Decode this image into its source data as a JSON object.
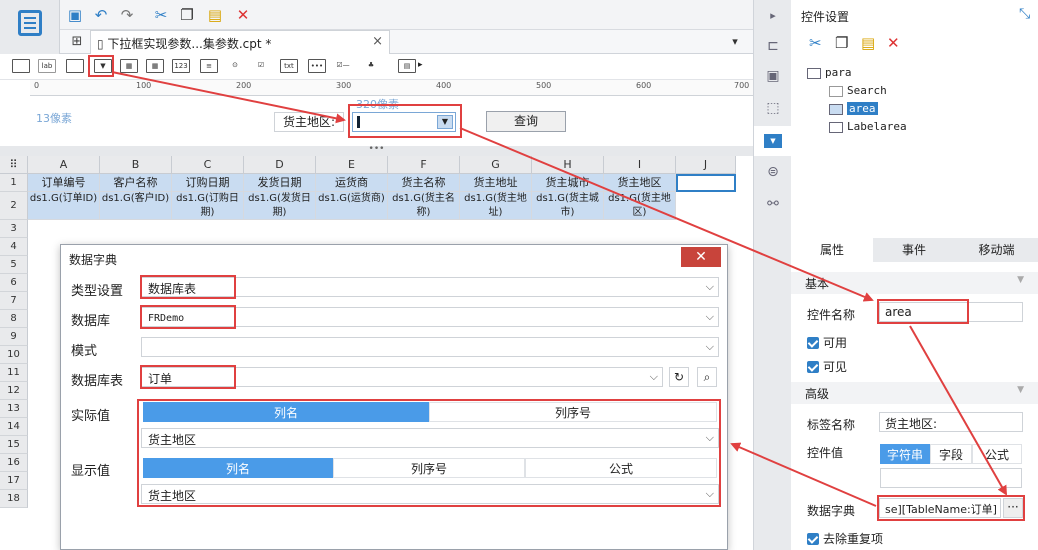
{
  "tab": {
    "title": "下拉框实现参数...集参数.cpt *",
    "close": "×"
  },
  "ruler": {
    "ticks": [
      "0",
      "100",
      "200",
      "300",
      "400",
      "500",
      "600",
      "700"
    ]
  },
  "param": {
    "margin_label": "13像素",
    "width_label": "320像素",
    "field_label": "货主地区:",
    "query_button": "查询",
    "collapse": "•••"
  },
  "grid": {
    "columns": [
      "A",
      "B",
      "C",
      "D",
      "E",
      "F",
      "G",
      "H",
      "I",
      "J"
    ],
    "rows": [
      "1",
      "2",
      "3",
      "4",
      "5",
      "6",
      "7",
      "8",
      "9",
      "10",
      "11",
      "12",
      "13",
      "14",
      "15",
      "16",
      "17",
      "18"
    ],
    "headers": [
      "订单编号",
      "客户名称",
      "订购日期",
      "发货日期",
      "运货商",
      "货主名称",
      "货主地址",
      "货主城市",
      "货主地区"
    ],
    "formulas": [
      "ds1.G(订单ID)",
      "ds1.G(客户ID)",
      "ds1.G(订购日期)",
      "ds1.G(发货日期)",
      "ds1.G(运货商)",
      "ds1.G(货主名称)",
      "ds1.G(货主地址)",
      "ds1.G(货主城市)",
      "ds1.G(货主地区)"
    ]
  },
  "panel": {
    "title": "控件设置",
    "tree": {
      "root": "para",
      "items": [
        "Search",
        "area",
        "Labelarea"
      ]
    },
    "tabs": [
      "属性",
      "事件",
      "移动端"
    ],
    "basic": "基本",
    "name_label": "控件名称",
    "name_value": "area",
    "enabled": "可用",
    "visible": "可见",
    "advanced": "高级",
    "tag_label": "标签名称",
    "tag_value": "货主地区:",
    "value_label": "控件值",
    "value_tabs": [
      "字符串",
      "字段",
      "公式"
    ],
    "dict_label": "数据字典",
    "dict_value": "se][TableName:订单]",
    "dict_more": "···",
    "dedupe": "去除重复项"
  },
  "dialog": {
    "title": "数据字典",
    "close": "✕",
    "type_label": "类型设置",
    "type_value": "数据库表",
    "db_label": "数据库",
    "db_value": "FRDemo",
    "schema_label": "模式",
    "schema_value": "",
    "table_label": "数据库表",
    "table_value": "订单",
    "actual_label": "实际值",
    "actual_tabs": [
      "列名",
      "列序号"
    ],
    "actual_value": "货主地区",
    "display_label": "显示值",
    "display_tabs": [
      "列名",
      "列序号",
      "公式"
    ],
    "display_value": "货主地区"
  },
  "colors": {
    "accent": "#4a9be8",
    "highlight": "#e04040",
    "header_cell": "#c9dcf1"
  }
}
